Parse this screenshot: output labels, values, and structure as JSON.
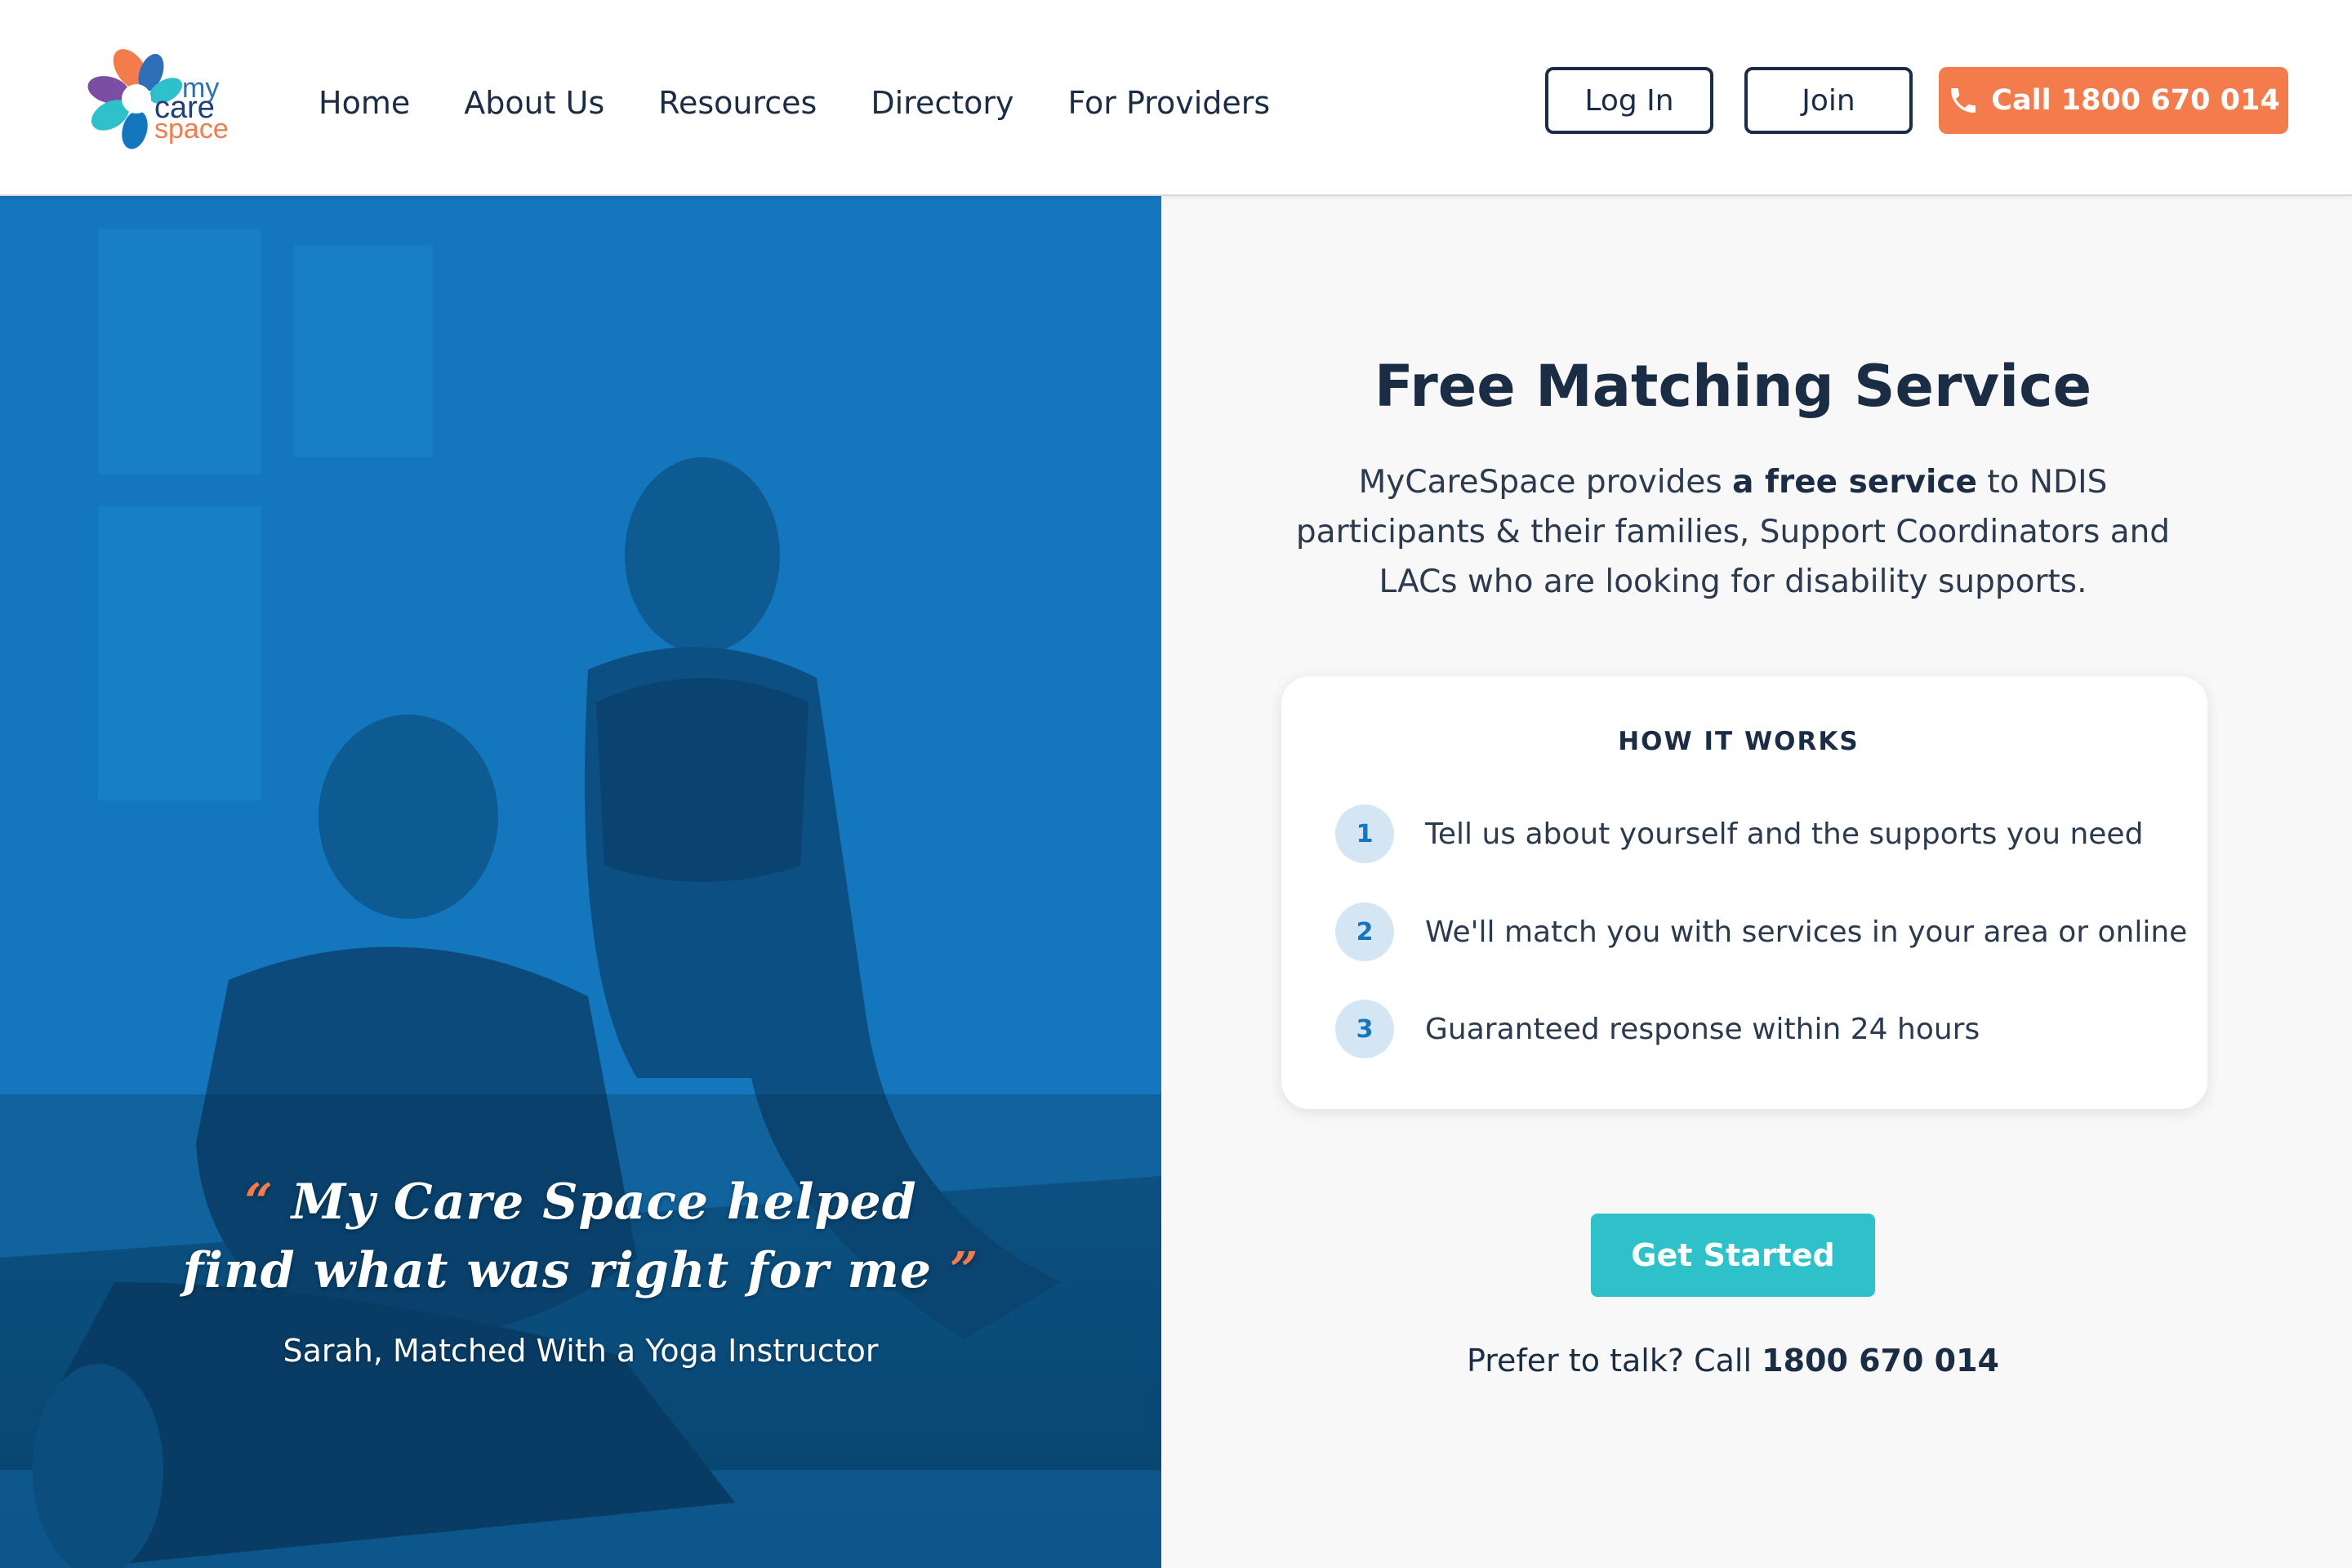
{
  "brand": {
    "logo_words": [
      "my",
      "care",
      "space"
    ],
    "colors": {
      "navy": "#1b2d45",
      "orange": "#f47b4b",
      "teal": "#2ec1c9",
      "blue": "#1477bd"
    }
  },
  "nav": {
    "items": [
      "Home",
      "About Us",
      "Resources",
      "Directory",
      "For Providers"
    ]
  },
  "header_actions": {
    "login_label": "Log In",
    "join_label": "Join",
    "call_label": "Call 1800 670 014",
    "call_icon": "phone-icon"
  },
  "hero": {
    "quote_line1": "My Care Space helped",
    "quote_line2": "find what was right for me",
    "open_quote": "“",
    "close_quote": "”",
    "attribution": "Sarah,  Matched With a Yoga Instructor"
  },
  "main": {
    "title": "Free Matching Service",
    "intro_before": "MyCareSpace provides ",
    "intro_bold": "a free service",
    "intro_after": " to NDIS participants & their families, Support Coordinators and LACs who are looking for disability supports.",
    "how_it_works": {
      "title": "HOW IT WORKS",
      "steps": [
        {
          "num": "1",
          "text": "Tell us about yourself and the supports you need"
        },
        {
          "num": "2",
          "text": "We'll match you with services in your area or online"
        },
        {
          "num": "3",
          "text": "Guaranteed response within 24 hours"
        }
      ]
    },
    "cta_label": "Get Started",
    "talk_prefix": "Prefer to talk? Call ",
    "talk_phone": "1800 670 014"
  }
}
